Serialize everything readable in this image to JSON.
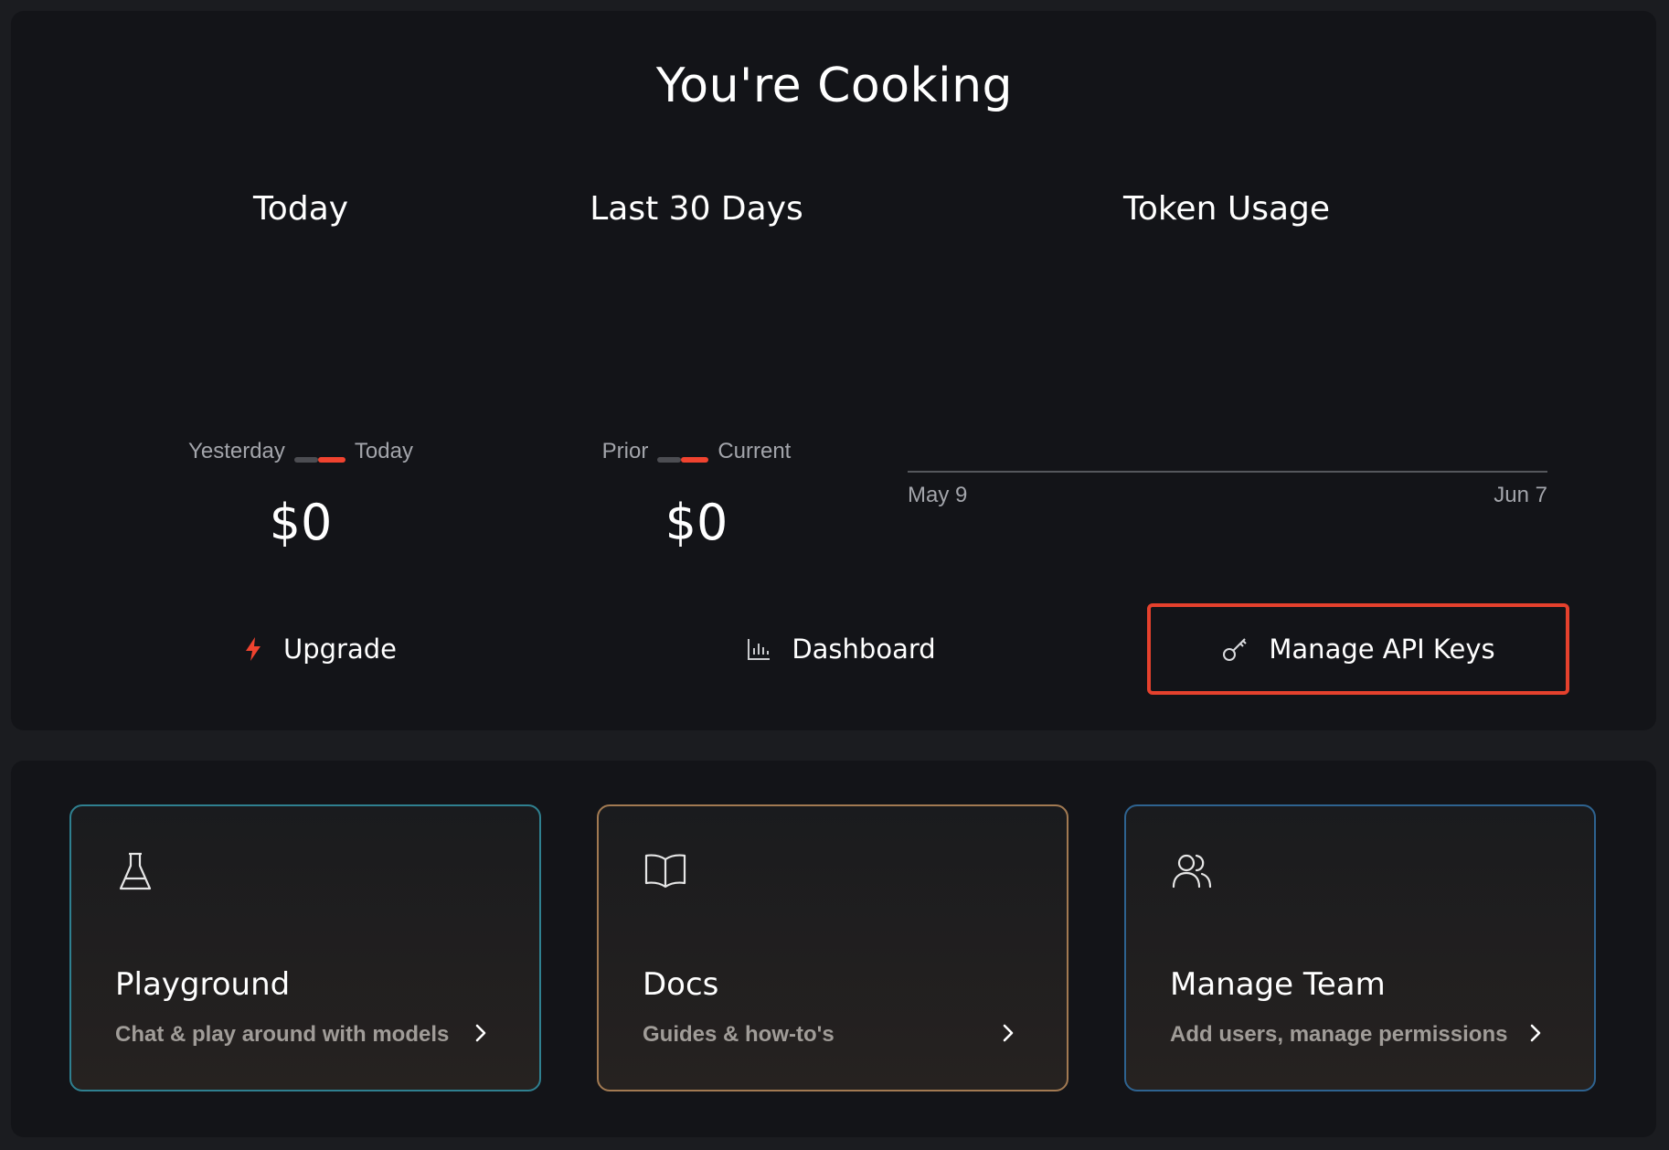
{
  "header": {
    "title": "You're Cooking"
  },
  "today": {
    "title": "Today",
    "compare_left": "Yesterday",
    "compare_right": "Today",
    "amount": "$0"
  },
  "last30": {
    "title": "Last 30 Days",
    "compare_left": "Prior",
    "compare_right": "Current",
    "amount": "$0"
  },
  "token_usage": {
    "title": "Token Usage",
    "axis_start": "May 9",
    "axis_end": "Jun 7"
  },
  "actions": {
    "upgrade": "Upgrade",
    "dashboard": "Dashboard",
    "manage_keys": "Manage API Keys"
  },
  "cards": [
    {
      "title": "Playground",
      "subtitle": "Chat & play around with models",
      "icon": "flask-icon"
    },
    {
      "title": "Docs",
      "subtitle": "Guides & how-to's",
      "icon": "book-icon"
    },
    {
      "title": "Manage Team",
      "subtitle": "Add users, manage permissions",
      "icon": "users-icon"
    }
  ],
  "colors": {
    "accent": "#f0432f",
    "highlight_border": "#e5412d",
    "playground_border": "#2f8090",
    "docs_border": "#a27a52",
    "team_border": "#2e6390"
  }
}
